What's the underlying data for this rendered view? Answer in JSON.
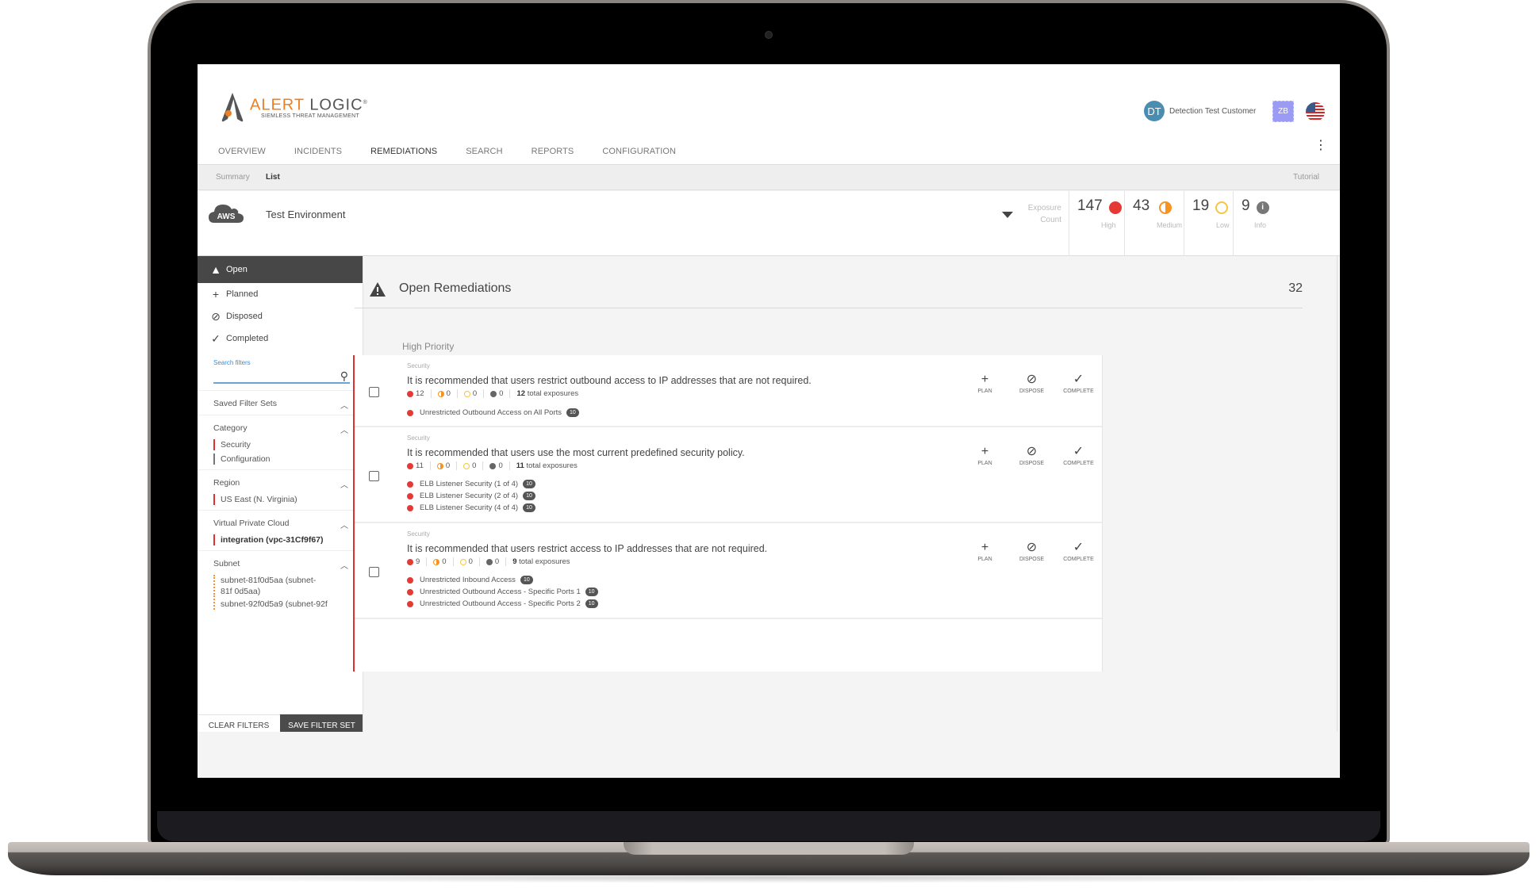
{
  "brand": {
    "name_part1": "ALERT",
    "name_part2": "LOGIC",
    "registered": "®",
    "tagline": "SIEMLESS THREAT MANAGEMENT",
    "accent_color": "#f07f22"
  },
  "nav": {
    "tabs": [
      {
        "label": "OVERVIEW",
        "active": false
      },
      {
        "label": "INCIDENTS",
        "active": false
      },
      {
        "label": "REMEDIATIONS",
        "active": true
      },
      {
        "label": "SEARCH",
        "active": false
      },
      {
        "label": "REPORTS",
        "active": false
      },
      {
        "label": "CONFIGURATION",
        "active": false
      }
    ],
    "more_icon": "kebab-vertical-icon"
  },
  "user": {
    "initials": "DT",
    "name": "Detection Test Customer",
    "secondary_initials": "ZB",
    "locale_icon": "us-flag-icon"
  },
  "subnav": {
    "items": [
      {
        "label": "Summary",
        "active": false
      },
      {
        "label": "List",
        "active": true
      }
    ],
    "tutorial_label": "Tutorial"
  },
  "environment": {
    "provider_label": "AWS",
    "name": "Test Environment",
    "exposure_label_line1": "Exposure",
    "exposure_label_line2": "Count",
    "counts": [
      {
        "value": "147",
        "label": "High",
        "color": "#e53935",
        "icon": "high-severity-icon"
      },
      {
        "value": "43",
        "label": "Medium",
        "color": "#f7931e",
        "icon": "medium-severity-icon"
      },
      {
        "value": "19",
        "label": "Low",
        "color": "#f9c440",
        "icon": "low-severity-icon"
      },
      {
        "value": "9",
        "label": "Info",
        "color": "#777777",
        "icon": "info-icon"
      }
    ]
  },
  "sidebar": {
    "status_tabs": [
      {
        "label": "Open",
        "icon": "warning-icon",
        "active": true
      },
      {
        "label": "Planned",
        "icon": "plus-icon",
        "active": false
      },
      {
        "label": "Disposed",
        "icon": "disposed-icon",
        "active": false
      },
      {
        "label": "Completed",
        "icon": "check-icon",
        "active": false
      }
    ],
    "search": {
      "label": "Search filters",
      "value": "",
      "placeholder": ""
    },
    "sections": [
      {
        "title": "Saved Filter Sets",
        "items": []
      },
      {
        "title": "Category",
        "items": [
          {
            "label": "Security",
            "color": "red"
          },
          {
            "label": "Configuration",
            "color": "gray"
          }
        ]
      },
      {
        "title": "Region",
        "items": [
          {
            "label": "US East (N. Virginia)",
            "color": "red"
          }
        ]
      },
      {
        "title": "Virtual Private Cloud",
        "items": [
          {
            "label": "integration (vpc-31Cf9f67)",
            "color": "red",
            "bold": true
          }
        ]
      },
      {
        "title": "Subnet",
        "items": [
          {
            "label": "subnet-81f0d5aa (subnet-81f 0d5aa)",
            "color": "orange"
          },
          {
            "label": "subnet-92f0d5a9 (subnet-92f",
            "color": "orange"
          }
        ]
      }
    ],
    "clear_label": "CLEAR FILTERS",
    "save_label": "SAVE FILTER SET"
  },
  "main": {
    "title": "Open Remediations",
    "count": "32",
    "group_title": "High Priority",
    "actions": [
      {
        "label": "PLAN",
        "icon": "plus-icon",
        "glyph": "+"
      },
      {
        "label": "DISPOSE",
        "icon": "disposed-icon",
        "glyph": "⊘"
      },
      {
        "label": "COMPLETE",
        "icon": "check-icon",
        "glyph": "✓"
      }
    ],
    "remediations": [
      {
        "category": "Security",
        "title": "It is recommended that users restrict outbound access to IP addresses that are not required.",
        "high": "12",
        "medium": "0",
        "low": "0",
        "info": "0",
        "total": "12",
        "total_label": "total exposures",
        "findings": [
          {
            "label": "Unrestricted Outbound Access on All Ports",
            "count": "10"
          }
        ]
      },
      {
        "category": "Security",
        "title": "It is recommended that users use the most current predefined security policy.",
        "high": "11",
        "medium": "0",
        "low": "0",
        "info": "0",
        "total": "11",
        "total_label": "total exposures",
        "findings": [
          {
            "label": "ELB Listener Security (1 of 4)",
            "count": "10"
          },
          {
            "label": "ELB Listener Security (2 of 4)",
            "count": "10"
          },
          {
            "label": "ELB Listener Security (4 of 4)",
            "count": "10"
          }
        ]
      },
      {
        "category": "Security",
        "title": "It is recommended that users restrict access to IP addresses that are not required.",
        "high": "9",
        "medium": "0",
        "low": "0",
        "info": "0",
        "total": "9",
        "total_label": "total exposures",
        "findings": [
          {
            "label": "Unrestricted Inbound Access",
            "count": "10"
          },
          {
            "label": "Unrestricted Outbound Access - Specific Ports 1",
            "count": "10"
          },
          {
            "label": "Unrestricted Outbound Access - Specific Ports 2",
            "count": "10"
          }
        ]
      }
    ]
  }
}
